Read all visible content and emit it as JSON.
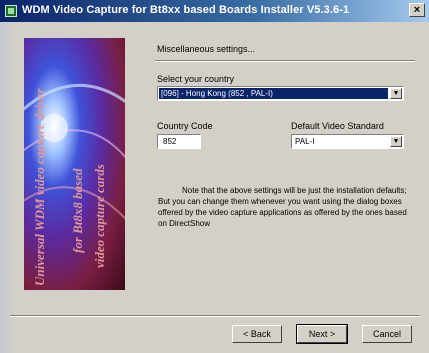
{
  "window": {
    "title": "WDM Video Capture for Bt8xx based Boards Installer V5.3.6-1",
    "close_label": "×"
  },
  "sidebar": {
    "line1": "Universal WDM video capture driver",
    "line2": "for Bt8x8 based",
    "line3": "video capture cards"
  },
  "main": {
    "section_title": "Miscellaneous settings...",
    "country": {
      "label": "Select your country",
      "value": "[096] - Hong Kong (852 , PAL-I)"
    },
    "country_code": {
      "label": "Country Code",
      "value": "852"
    },
    "video_standard": {
      "label": "Default Video Standard",
      "value": "PAL-I"
    },
    "note": "Note that the above settings will be just the installation defaults; But you can change them whenever you want using the dialog boxes offered by the video capture applications as offered by the ones based on DirectShow"
  },
  "buttons": {
    "back": "< Back",
    "next": "Next >",
    "cancel": "Cancel"
  }
}
